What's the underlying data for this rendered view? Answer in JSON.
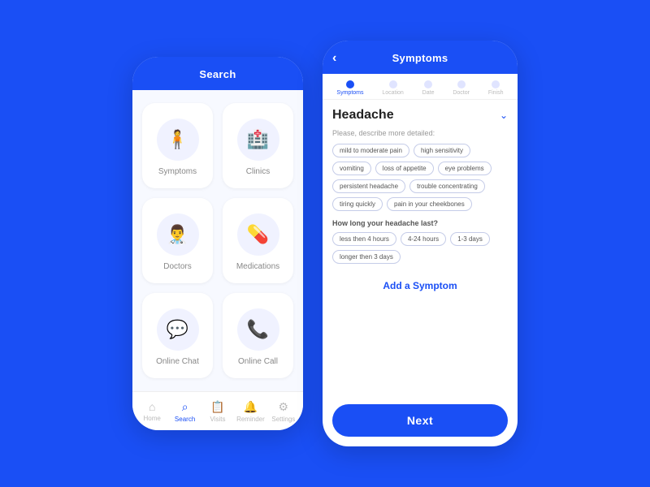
{
  "leftPhone": {
    "header": "Search",
    "gridItems": [
      {
        "id": "symptoms",
        "label": "Symptoms",
        "icon": "🧍"
      },
      {
        "id": "clinics",
        "label": "Clinics",
        "icon": "🏥"
      },
      {
        "id": "doctors",
        "label": "Doctors",
        "icon": "👨‍⚕️"
      },
      {
        "id": "medications",
        "label": "Medications",
        "icon": "💊"
      },
      {
        "id": "online-chat",
        "label": "Online Chat",
        "icon": "💬"
      },
      {
        "id": "online-call",
        "label": "Online Call",
        "icon": "📞"
      }
    ],
    "navItems": [
      {
        "id": "home",
        "label": "Home",
        "icon": "🏠",
        "active": false
      },
      {
        "id": "search",
        "label": "Search",
        "icon": "🔍",
        "active": true
      },
      {
        "id": "visits",
        "label": "Visits",
        "icon": "📋",
        "active": false
      },
      {
        "id": "reminder",
        "label": "Reminder",
        "icon": "🔔",
        "active": false
      },
      {
        "id": "settings",
        "label": "Settings",
        "icon": "⚙️",
        "active": false
      }
    ]
  },
  "rightPhone": {
    "header": "Symptoms",
    "steps": [
      {
        "id": "symptoms",
        "label": "Symptoms",
        "active": true
      },
      {
        "id": "location",
        "label": "Location",
        "active": false
      },
      {
        "id": "date",
        "label": "Date",
        "active": false
      },
      {
        "id": "doctor",
        "label": "Doctor",
        "active": false
      },
      {
        "id": "finish",
        "label": "Finish",
        "active": false
      }
    ],
    "symptomTitle": "Headache",
    "describeLabel": "Please, describe more detailed:",
    "tags": [
      {
        "id": "mild-pain",
        "label": "mild to moderate pain",
        "selected": false
      },
      {
        "id": "high-sensitivity",
        "label": "high sensitivity",
        "selected": false
      },
      {
        "id": "vomiting",
        "label": "vomiting",
        "selected": false
      },
      {
        "id": "loss-appetite",
        "label": "loss of appetite",
        "selected": false
      },
      {
        "id": "eye-problems",
        "label": "eye problems",
        "selected": false
      },
      {
        "id": "persistent-headache",
        "label": "persistent headache",
        "selected": false
      },
      {
        "id": "trouble-concentrating",
        "label": "trouble concentrating",
        "selected": false
      },
      {
        "id": "tiring-quickly",
        "label": "tiring quickly",
        "selected": false
      },
      {
        "id": "cheekbones-pain",
        "label": "pain in your cheekbones",
        "selected": false
      }
    ],
    "durationLabel": "How long your headache last?",
    "durationTags": [
      {
        "id": "less-4h",
        "label": "less then 4 hours",
        "selected": false
      },
      {
        "id": "4-24h",
        "label": "4-24 hours",
        "selected": false
      },
      {
        "id": "1-3d",
        "label": "1-3 days",
        "selected": false
      },
      {
        "id": "more-3d",
        "label": "longer then 3 days",
        "selected": false
      }
    ],
    "addSymptomLabel": "Add a Symptom",
    "nextLabel": "Next"
  }
}
